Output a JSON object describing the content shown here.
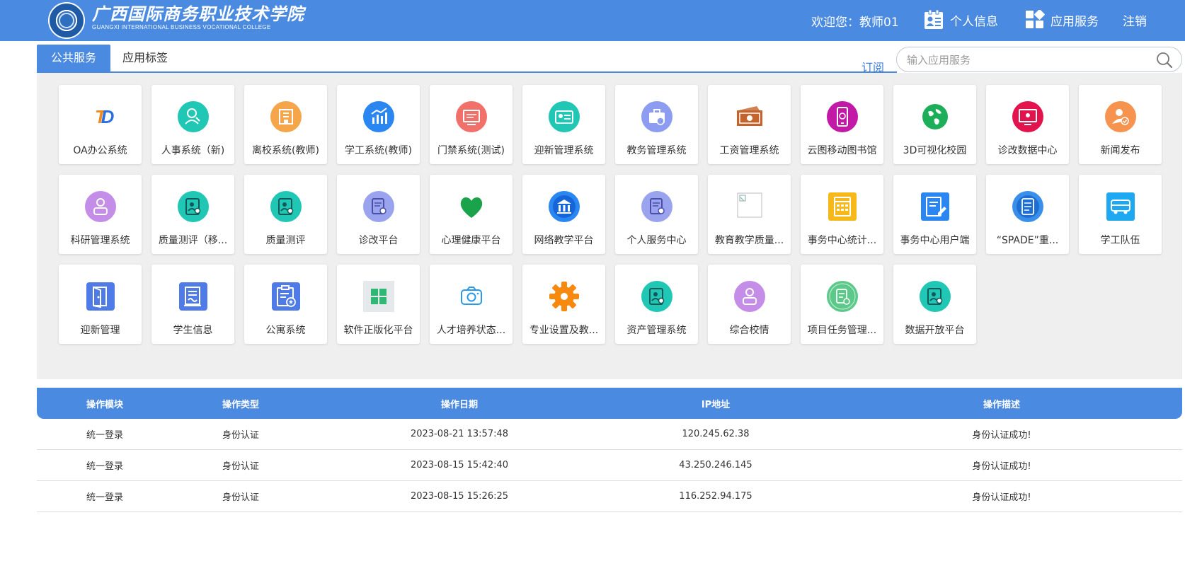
{
  "header": {
    "school_name_cn": "广西国际商务职业技术学院",
    "school_name_en": "GUANGXI INTERNATIONAL BUSINESS VOCATIONAL COLLEGE",
    "welcome_prefix": "欢迎您：",
    "user_name": "教师01",
    "personal_info": "个人信息",
    "app_service": "应用服务",
    "logout": "注销",
    "brand_color": "#4a8ae0"
  },
  "tabs": [
    {
      "label": "公共服务",
      "active": true
    },
    {
      "label": "应用标签",
      "active": false
    }
  ],
  "subscribe_label": "订阅",
  "search": {
    "placeholder": "输入应用服务",
    "value": ""
  },
  "apps": [
    {
      "label": "OA办公系统",
      "icon": "td-logo-icon",
      "color": "#f08a1d"
    },
    {
      "label": "人事系统（新)",
      "icon": "person-search-icon",
      "color": "#1fc7b4"
    },
    {
      "label": "离校系统(教师)",
      "icon": "building-icon",
      "color": "#f5a64a"
    },
    {
      "label": "学工系统(教师)",
      "icon": "chart-icon",
      "color": "#2a86f0"
    },
    {
      "label": "门禁系统(测试)",
      "icon": "monitor-icon",
      "color": "#f2706a"
    },
    {
      "label": "迎新管理系统",
      "icon": "id-card-icon",
      "color": "#1fc7b4"
    },
    {
      "label": "教务管理系统",
      "icon": "briefcase-icon",
      "color": "#8c9cf0"
    },
    {
      "label": "工资管理系统",
      "icon": "money-icon",
      "color": "#c4632b"
    },
    {
      "label": "云图移动图书馆",
      "icon": "phone-icon",
      "color": "#c21aa7"
    },
    {
      "label": "3D可视化校园",
      "icon": "globe-icon",
      "color": "#1dae5a"
    },
    {
      "label": "诊改数据中心",
      "icon": "screen-icon",
      "color": "#e3134e"
    },
    {
      "label": "新闻发布",
      "icon": "user-check-icon",
      "color": "#f5934f"
    },
    {
      "label": "科研管理系统",
      "icon": "person-icon",
      "color": "#c48de8"
    },
    {
      "label": "质量测评（移...",
      "icon": "profile-search-icon",
      "color": "#1fc7b4"
    },
    {
      "label": "质量测评",
      "icon": "profile-search-icon",
      "color": "#1fc7b4"
    },
    {
      "label": "诊改平台",
      "icon": "document-icon",
      "color": "#9aa4ee"
    },
    {
      "label": "心理健康平台",
      "icon": "heart-icon",
      "color": "#1aa34a"
    },
    {
      "label": "网络教学平台",
      "icon": "bank-icon",
      "color": "#2a86f0"
    },
    {
      "label": "个人服务中心",
      "icon": "document-icon",
      "color": "#9aa4ee"
    },
    {
      "label": "教育教学质量...",
      "icon": "broken-image-icon",
      "color": "#999999"
    },
    {
      "label": "事务中心统计...",
      "icon": "calendar-icon",
      "color": "#f7b81a"
    },
    {
      "label": "事务中心用户端",
      "icon": "edit-form-icon",
      "color": "#2a86f0"
    },
    {
      "label": "“SPADE”重...",
      "icon": "list-doc-icon",
      "color": "#3a8fe8"
    },
    {
      "label": "学工队伍",
      "icon": "bus-icon",
      "color": "#1ea8f2"
    },
    {
      "label": "迎新管理",
      "icon": "door-icon",
      "color": "#4f7be8"
    },
    {
      "label": "学生信息",
      "icon": "form-icon",
      "color": "#4f7be8"
    },
    {
      "label": "公寓系统",
      "icon": "clipboard-star-icon",
      "color": "#4f7be8"
    },
    {
      "label": "软件正版化平台",
      "icon": "windows-icon",
      "color": "#2fb874"
    },
    {
      "label": "人才培养状态...",
      "icon": "camera-icon",
      "color": "#2a9ae8"
    },
    {
      "label": "专业设置及教...",
      "icon": "gear-icon",
      "color": "#f7890f"
    },
    {
      "label": "资产管理系统",
      "icon": "profile-search-icon",
      "color": "#1fc7b4"
    },
    {
      "label": "综合校情",
      "icon": "person-icon",
      "color": "#c48de8"
    },
    {
      "label": "项目任务管理...",
      "icon": "task-icon",
      "color": "#5cc98a"
    },
    {
      "label": "数据开放平台",
      "icon": "profile-search-icon",
      "color": "#1fc7b4"
    }
  ],
  "log_table": {
    "headers": [
      "操作模块",
      "操作类型",
      "操作日期",
      "IP地址",
      "操作描述"
    ],
    "rows": [
      [
        "统一登录",
        "身份认证",
        "2023-08-21 13:57:48",
        "120.245.62.38",
        "身份认证成功!"
      ],
      [
        "统一登录",
        "身份认证",
        "2023-08-15 15:42:40",
        "43.250.246.145",
        "身份认证成功!"
      ],
      [
        "统一登录",
        "身份认证",
        "2023-08-15 15:26:25",
        "116.252.94.175",
        "身份认证成功!"
      ]
    ]
  }
}
